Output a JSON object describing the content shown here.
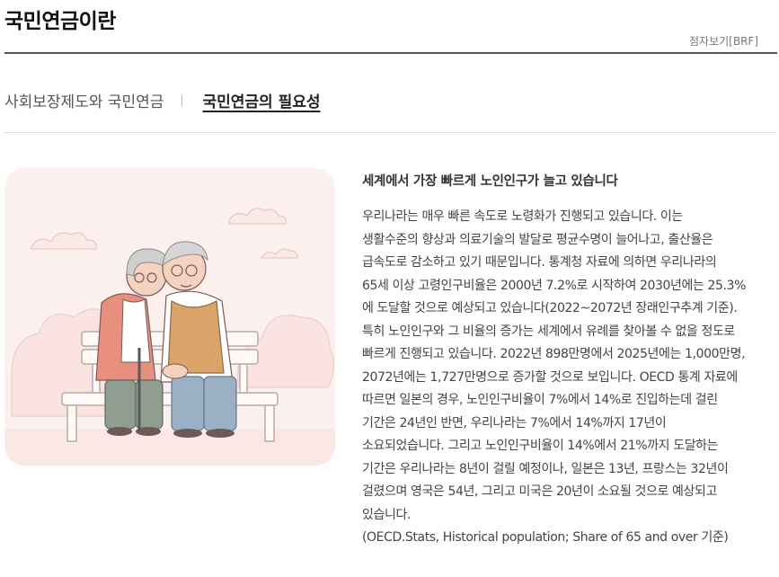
{
  "header": {
    "title": "국민연금이란",
    "braille_link": "점자보기[BRF]"
  },
  "tabs": [
    {
      "label": "사회보장제도와 국민연금",
      "active": false
    },
    {
      "label": "국민연금의 필요성",
      "active": true
    }
  ],
  "illustration": {
    "description_icon": "elderly-couple-on-bench-illustration",
    "background_color": "#fdf1ef"
  },
  "content": {
    "heading": "세계에서 가장 빠르게 노인인구가 늘고 있습니다",
    "lines": [
      "우리나라는 매우 빠른 속도로 노령화가 진행되고 있습니다. 이는",
      "생활수준의 향상과 의료기술의 발달로 평균수명이 늘어나고, 출산율은",
      "급속도로 감소하고 있기 때문입니다. 통계청 자료에 의하면 우리나라의",
      "65세 이상 고령인구비율은 2000년 7.2%로 시작하여 2030년에는 25.3%",
      "에 도달할 것으로 예상되고 있습니다(2022~2072년 장래인구추계 기준).",
      "특히 노인인구와 그 비율의 증가는 세계에서 유례를 찾아볼 수 없을 정도로",
      "빠르게 진행되고 있습니다. 2022년 898만명에서 2025년에는 1,000만명,",
      "2072년에는 1,727만명으로 증가할 것으로 보입니다. OECD 통계 자료에",
      "따르면 일본의 경우, 노인인구비율이 7%에서 14%로 진입하는데 걸린",
      "기간은 24년인 반면, 우리나라는 7%에서 14%까지 17년이",
      "소요되었습니다. 그리고 노인인구비율이 14%에서 21%까지 도달하는",
      "기간은 우리나라는 8년이 걸릴 예정이나, 일본은 13년, 프랑스는 32년이",
      "걸렸으며 영국은 54년, 그리고 미국은 20년이 소요될 것으로 예상되고",
      "있습니다.",
      "(OECD.Stats, Historical population; Share of 65 and over 기준)"
    ]
  }
}
